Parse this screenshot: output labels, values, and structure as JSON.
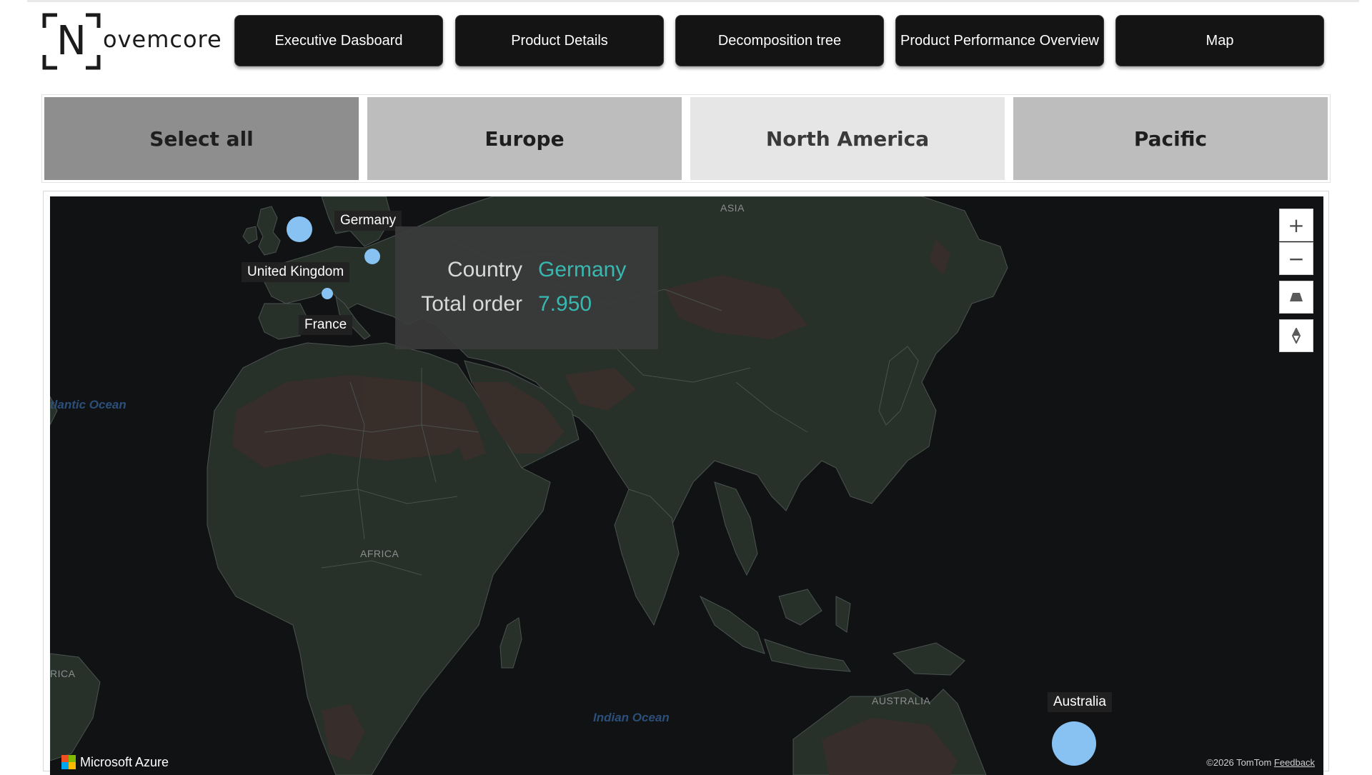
{
  "brand": {
    "logo_letter": "N",
    "logo_word": "ovemcore"
  },
  "nav": [
    {
      "label": "Executive Dasboard"
    },
    {
      "label": "Product Details"
    },
    {
      "label": "Decomposition tree"
    },
    {
      "label": "Product Performance Overview"
    },
    {
      "label": "Map"
    }
  ],
  "region_slicer": {
    "options": [
      {
        "label": "Select all",
        "state": "selected",
        "color": "#8e8e8e"
      },
      {
        "label": "Europe",
        "state": "normal",
        "color": "#bdbdbd"
      },
      {
        "label": "North America",
        "state": "dimmed",
        "color": "#e6e6e6"
      },
      {
        "label": "Pacific",
        "state": "normal",
        "color": "#bdbdbd"
      }
    ]
  },
  "map": {
    "region_labels": {
      "asia": "ASIA",
      "africa": "AFRICA",
      "australia": "AUSTRALIA",
      "america": "RICA"
    },
    "ocean_labels": {
      "atlantic": "tlantic Ocean",
      "indian": "Indian Ocean"
    },
    "countries": [
      {
        "name": "United Kingdom"
      },
      {
        "name": "Germany"
      },
      {
        "name": "France"
      },
      {
        "name": "Australia"
      }
    ],
    "tooltip": {
      "country_key": "Country",
      "country_value": "Germany",
      "order_key": "Total order",
      "order_value": "7.950"
    },
    "controls": {
      "zoom_in": "+",
      "zoom_out": "−"
    },
    "attribution": {
      "azure": "Microsoft Azure",
      "copyright": "©2026 TomTom",
      "feedback": "Feedback"
    },
    "colors": {
      "ocean": "#111214",
      "land": "#273029",
      "desert": "#3a2e2b",
      "bubble": "#87c2f3",
      "tooltip_value": "#37b9b2"
    }
  }
}
